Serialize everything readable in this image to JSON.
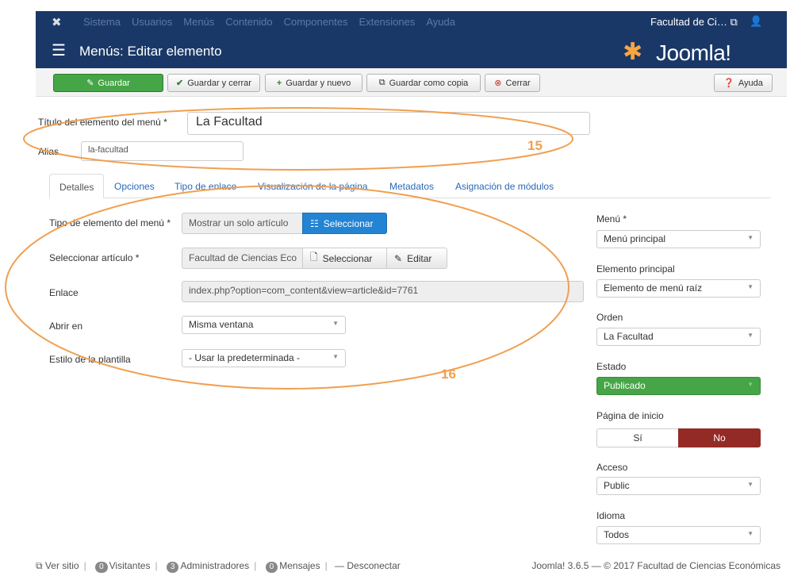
{
  "top_menu": {
    "items": [
      "Sistema",
      "Usuarios",
      "Menús",
      "Contenido",
      "Componentes",
      "Extensiones",
      "Ayuda"
    ],
    "site_name": "Facultad de Ci…"
  },
  "header": {
    "title": "Menús: Editar elemento",
    "logo_text": "Joomla!"
  },
  "toolbar": {
    "save": "Guardar",
    "save_close": "Guardar y cerrar",
    "save_new": "Guardar y nuevo",
    "save_copy": "Guardar como copia",
    "close": "Cerrar",
    "help": "Ayuda"
  },
  "form": {
    "title_label": "Título del elemento del menú *",
    "title_value": "La Facultad",
    "alias_label": "Alias",
    "alias_value": "la-facultad"
  },
  "tabs": [
    "Detalles",
    "Opciones",
    "Tipo de enlace",
    "Visualización de la página",
    "Metadatos",
    "Asignación de módulos"
  ],
  "details": {
    "type_label": "Tipo de elemento del menú *",
    "type_value": "Mostrar un solo artículo",
    "select_btn": "Seleccionar",
    "article_label": "Seleccionar artículo *",
    "article_value": "Facultad de Ciencias Eco",
    "article_select": "Seleccionar",
    "article_edit": "Editar",
    "link_label": "Enlace",
    "link_value": "index.php?option=com_content&view=article&id=7761",
    "open_label": "Abrir en",
    "open_value": "Misma ventana",
    "style_label": "Estilo de la plantilla",
    "style_value": "- Usar la predeterminada -"
  },
  "sidebar": {
    "menu_label": "Menú *",
    "menu_value": "Menú principal",
    "parent_label": "Elemento principal",
    "parent_value": "Elemento de menú raíz",
    "order_label": "Orden",
    "order_value": "La Facultad",
    "status_label": "Estado",
    "status_value": "Publicado",
    "home_label": "Página de inicio",
    "home_yes": "Sí",
    "home_no": "No",
    "access_label": "Acceso",
    "access_value": "Public",
    "lang_label": "Idioma",
    "lang_value": "Todos"
  },
  "annotations": {
    "a15": "15",
    "a16": "16"
  },
  "statusbar": {
    "view_site": "Ver sitio",
    "visitors_count": "0",
    "visitors": "Visitantes",
    "admins_count": "3",
    "admins": "Administradores",
    "messages_count": "0",
    "messages": "Mensajes",
    "logout": "Desconectar",
    "version": "Joomla! 3.6.5 — © 2017 Facultad de Ciencias Económicas"
  },
  "colors": {
    "navy": "#1a3867",
    "green": "#46a546",
    "blue": "#2384d3",
    "red": "#942a25",
    "annotation": "#f0a050"
  }
}
